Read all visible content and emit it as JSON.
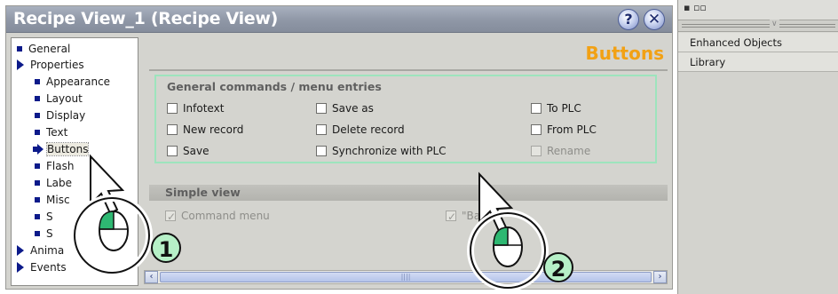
{
  "window": {
    "title": "Recipe View_1 (Recipe View)",
    "help_icon": "help-icon",
    "close_icon": "close-icon"
  },
  "tree": {
    "items": [
      {
        "label": "General",
        "marker": "square"
      },
      {
        "label": "Properties",
        "marker": "triangle"
      },
      {
        "label": "Appearance",
        "marker": "square"
      },
      {
        "label": "Layout",
        "marker": "square"
      },
      {
        "label": "Display",
        "marker": "square"
      },
      {
        "label": "Text",
        "marker": "square"
      },
      {
        "label": "Buttons",
        "marker": "arrow",
        "selected": true
      },
      {
        "label": "Flash",
        "marker": "square"
      },
      {
        "label": "Labe",
        "marker": "square"
      },
      {
        "label": "Misc",
        "marker": "square"
      },
      {
        "label": "S",
        "marker": "square"
      },
      {
        "label": "S",
        "marker": "square"
      },
      {
        "label": "Anima",
        "marker": "triangle"
      },
      {
        "label": "Events",
        "marker": "triangle"
      }
    ]
  },
  "settings": {
    "heading": "Buttons",
    "general_group": {
      "title": "General commands / menu entries",
      "options": [
        {
          "label": "Infotext",
          "checked": false,
          "enabled": true
        },
        {
          "label": "New record",
          "checked": false,
          "enabled": true
        },
        {
          "label": "Save",
          "checked": false,
          "enabled": true
        },
        {
          "label": "Save as",
          "checked": false,
          "enabled": true
        },
        {
          "label": "Delete record",
          "checked": false,
          "enabled": true
        },
        {
          "label": "Synchronize with PLC",
          "checked": false,
          "enabled": true
        },
        {
          "label": "To PLC",
          "checked": false,
          "enabled": true
        },
        {
          "label": "From PLC",
          "checked": false,
          "enabled": true
        },
        {
          "label": "Rename",
          "checked": false,
          "enabled": false
        }
      ]
    },
    "simple_group": {
      "title": "Simple view",
      "options": [
        {
          "label": "Command menu",
          "checked": true,
          "enabled": false
        },
        {
          "label": "\"Ba",
          "checked": true,
          "enabled": false
        }
      ]
    },
    "scrollbar": {
      "left_arrow": "‹",
      "right_arrow": "›",
      "thumb_grip": "||||"
    }
  },
  "right_panel": {
    "items": [
      "Enhanced Objects",
      "Library"
    ]
  },
  "callouts": [
    {
      "number": "1"
    },
    {
      "number": "2"
    }
  ],
  "colors": {
    "heading_accent": "#f2a114",
    "highlight_box": "#9de4bd",
    "tree_marker": "#0c1a8a",
    "callout_fill": "#b6f0c7"
  }
}
